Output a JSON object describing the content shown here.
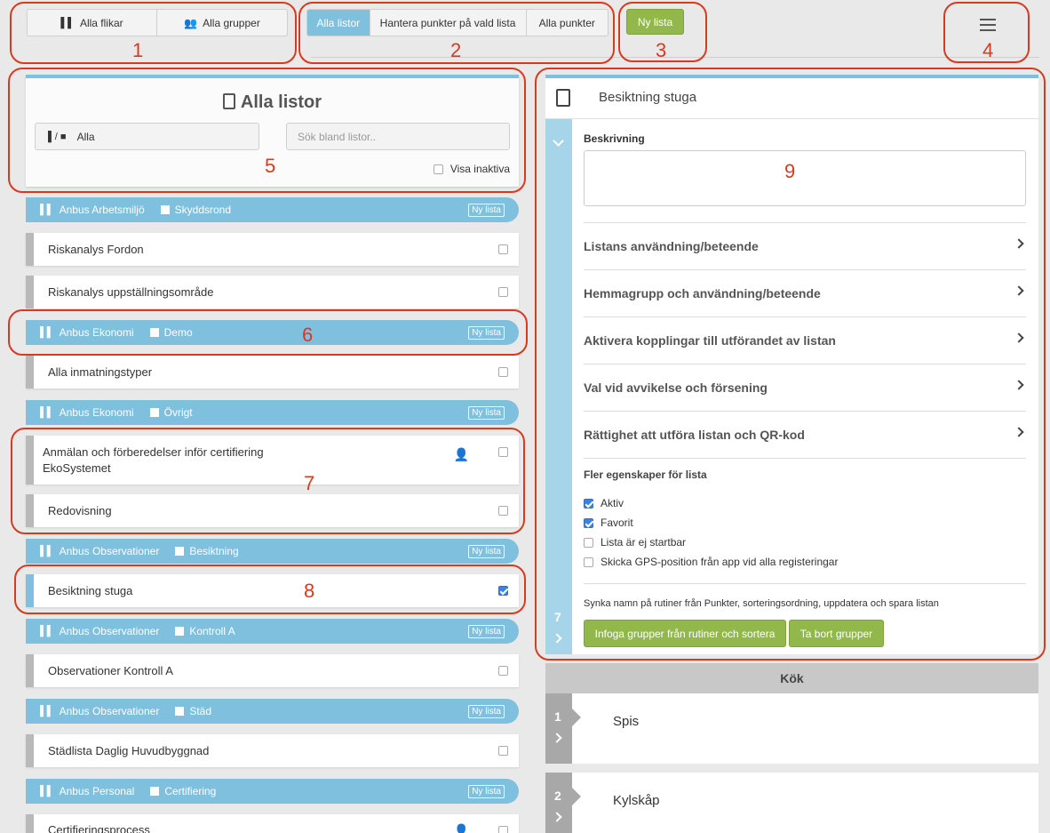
{
  "toolbar": {
    "tabs_all": "Alla flikar",
    "groups_all": "Alla grupper",
    "seg_all_lists": "Alla listor",
    "seg_manage": "Hantera punkter på vald lista",
    "seg_all_points": "Alla punkter",
    "new_list": "Ny lista"
  },
  "annotations": [
    "1",
    "2",
    "3",
    "4",
    "5",
    "6",
    "7",
    "8",
    "9"
  ],
  "filter": {
    "title": "Alla listor",
    "scope_value": "Alla",
    "search_placeholder": "Sök bland listor..",
    "show_inactive": "Visa inaktiva"
  },
  "groups": [
    {
      "tab": "Anbus Arbetsmiljö",
      "group": "Skyddsrond",
      "badge": "Ny lista"
    },
    {
      "tab": "Anbus Ekonomi",
      "group": "Demo",
      "badge": "Ny lista"
    },
    {
      "tab": "Anbus Ekonomi",
      "group": "Övrigt",
      "badge": "Ny lista"
    },
    {
      "tab": "Anbus Observationer",
      "group": "Besiktning",
      "badge": "Ny lista"
    },
    {
      "tab": "Anbus Observationer",
      "group": "Kontroll A",
      "badge": "Ny lista"
    },
    {
      "tab": "Anbus Observationer",
      "group": "Städ",
      "badge": "Ny lista"
    },
    {
      "tab": "Anbus Personal",
      "group": "Certifiering",
      "badge": "Ny lista"
    }
  ],
  "lists": [
    "Riskanalys Fordon",
    "Riskanalys uppställningsområde",
    "Alla inmatningstyper",
    "Anmälan och förberedelser inför certifiering EkoSystemet",
    "Redovisning",
    "Besiktning stuga",
    "Observationer Kontroll A",
    "Städlista Daglig Huvudbyggnad",
    "Certifieringsprocess"
  ],
  "detail": {
    "title": "Besiktning stuga",
    "description_label": "Beskrivning",
    "sections": [
      "Listans användning/beteende",
      "Hemmagrupp och användning/beteende",
      "Aktivera kopplingar till utförandet av listan",
      "Val vid avvikelse och försening",
      "Rättighet att utföra listan och QR-kod"
    ],
    "more_props": "Fler egenskaper för lista",
    "props": [
      "Aktiv",
      "Favorit",
      "Lista är ej startbar",
      "Skicka GPS-position från app vid alla registeringar"
    ],
    "sync_text": "Synka namn på rutiner från Punkter, sorteringsordning, uppdatera och spara listan",
    "btn_insert": "Infoga grupper från rutiner och sortera",
    "btn_remove": "Ta bort grupper",
    "count": "7"
  },
  "section_header": "Kök",
  "steps": [
    {
      "num": "1",
      "name": "Spis"
    },
    {
      "num": "2",
      "name": "Kylskåp"
    }
  ],
  "colors": {
    "accent": "#7fc0df",
    "green": "#92b84b",
    "annotation": "#d83a1e"
  }
}
